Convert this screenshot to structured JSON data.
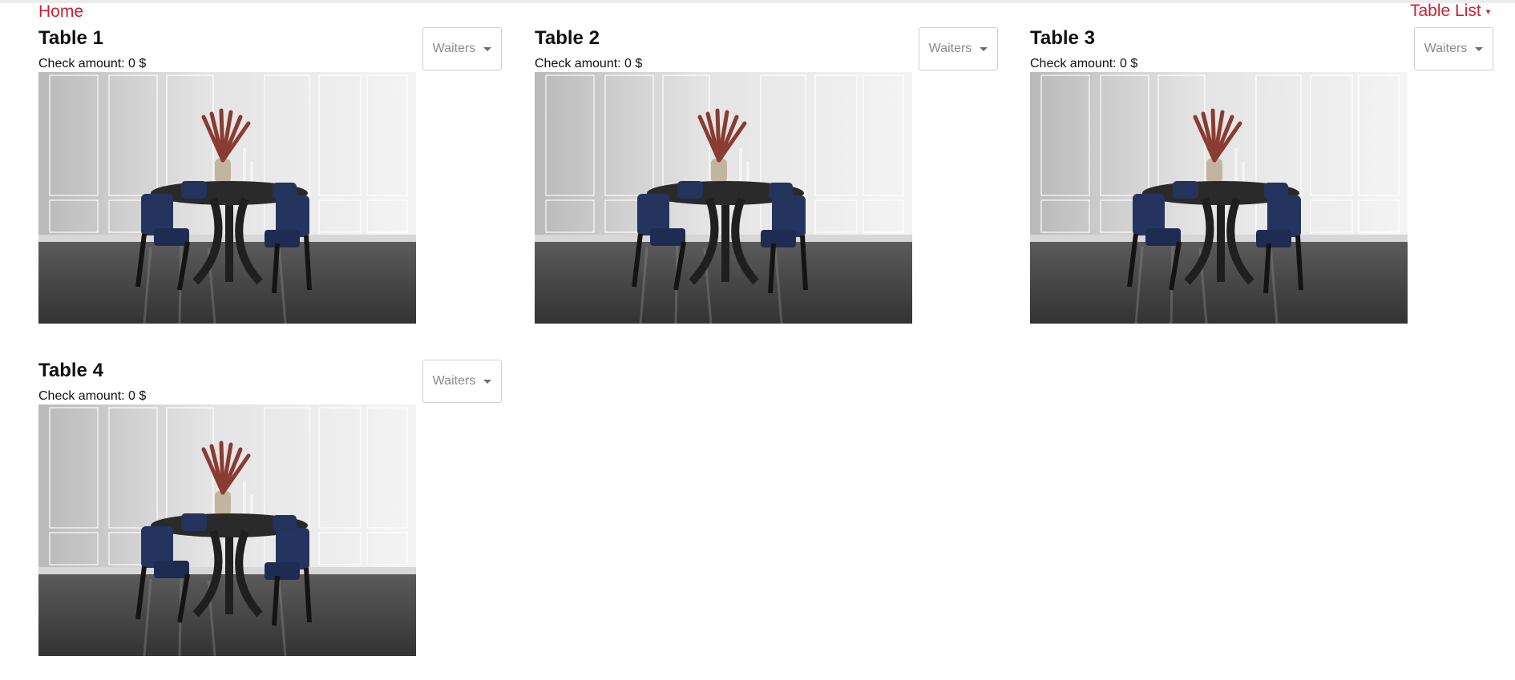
{
  "nav": {
    "home_label": "Home",
    "table_list_label": "Table List",
    "caret_glyph": "▾"
  },
  "tables": [
    {
      "title": "Table 1",
      "check_text": "Check amount: 0 $",
      "waiters_label": "Waiters",
      "image": "dining-table-photo"
    },
    {
      "title": "Table 2",
      "check_text": "Check amount: 0 $",
      "waiters_label": "Waiters",
      "image": "dining-table-photo"
    },
    {
      "title": "Table 3",
      "check_text": "Check amount: 0 $",
      "waiters_label": "Waiters",
      "image": "dining-table-photo"
    },
    {
      "title": "Table 4",
      "check_text": "Check amount: 0 $",
      "waiters_label": "Waiters",
      "image": "dining-table-photo"
    }
  ],
  "colors": {
    "accent": "#cc1f2f",
    "text": "#111111",
    "muted": "#8a8a8a",
    "border": "#cfcfcf"
  }
}
